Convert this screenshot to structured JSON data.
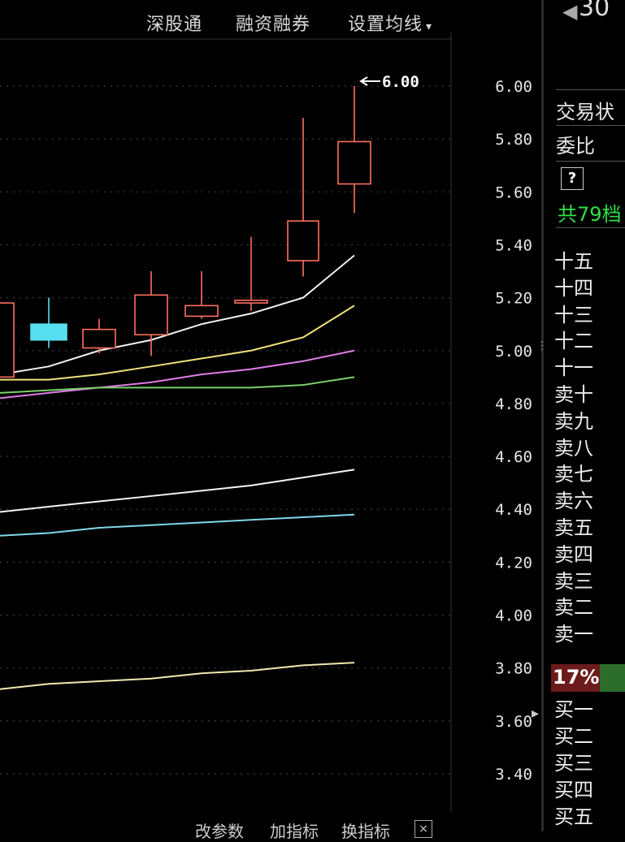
{
  "toolbar": {
    "items": [
      "深股通",
      "融资融券",
      "设置均线"
    ],
    "dropdown_icon": "caret-down-icon"
  },
  "chart_data": {
    "type": "candlestick",
    "y_ticks": [
      6.0,
      5.8,
      5.6,
      5.4,
      5.2,
      5.0,
      4.8,
      4.6,
      4.4,
      4.2,
      4.0,
      3.8,
      3.6,
      3.4
    ],
    "ylim": [
      3.4,
      6.0
    ],
    "grid": true,
    "max_annotation": "6.00",
    "candles": [
      {
        "open": 4.9,
        "close": 5.18,
        "high": 5.18,
        "low": 4.9,
        "color": "red"
      },
      {
        "open": 5.1,
        "close": 5.04,
        "high": 5.2,
        "low": 5.01,
        "color": "cyan"
      },
      {
        "open": 5.01,
        "close": 5.08,
        "high": 5.12,
        "low": 4.99,
        "color": "red"
      },
      {
        "open": 5.06,
        "close": 5.21,
        "high": 5.3,
        "low": 4.98,
        "color": "red"
      },
      {
        "open": 5.13,
        "close": 5.17,
        "high": 5.3,
        "low": 5.12,
        "color": "red"
      },
      {
        "open": 5.18,
        "close": 5.19,
        "high": 5.43,
        "low": 5.15,
        "color": "red"
      },
      {
        "open": 5.34,
        "close": 5.49,
        "high": 5.88,
        "low": 5.28,
        "color": "red"
      },
      {
        "open": 5.63,
        "close": 5.79,
        "high": 6.0,
        "low": 5.52,
        "color": "red"
      }
    ],
    "moving_averages": [
      {
        "color": "#f2f2f2",
        "values": [
          4.91,
          4.94,
          5.0,
          5.04,
          5.1,
          5.14,
          5.2,
          5.36
        ]
      },
      {
        "color": "#f0e27a",
        "values": [
          4.89,
          4.89,
          4.91,
          4.94,
          4.97,
          5.0,
          5.05,
          5.17
        ]
      },
      {
        "color": "#e07ce8",
        "values": [
          4.82,
          4.84,
          4.86,
          4.88,
          4.91,
          4.93,
          4.96,
          5.0
        ]
      },
      {
        "color": "#7ad06a",
        "values": [
          4.84,
          4.85,
          4.86,
          4.86,
          4.86,
          4.86,
          4.87,
          4.9
        ]
      },
      {
        "color": "#f5f5f5",
        "values": [
          4.39,
          4.41,
          4.43,
          4.45,
          4.47,
          4.49,
          4.52,
          4.55
        ]
      },
      {
        "color": "#7fd8e8",
        "values": [
          4.3,
          4.31,
          4.33,
          4.34,
          4.35,
          4.36,
          4.37,
          4.38
        ]
      },
      {
        "color": "#f0eab0",
        "values": [
          3.72,
          3.74,
          3.75,
          3.76,
          3.78,
          3.79,
          3.81,
          3.82
        ]
      }
    ]
  },
  "panel": {
    "title": "30",
    "rows": [
      "交易状",
      "委比"
    ],
    "help": "?",
    "total_levels": "共79档",
    "asks": [
      "十五",
      "十四",
      "十三",
      "十二",
      "十一",
      "卖十",
      "卖九",
      "卖八",
      "卖七",
      "卖六",
      "卖五",
      "卖四",
      "卖三",
      "卖二",
      "卖一"
    ],
    "ratio": "17%",
    "bids": [
      "买一",
      "买二",
      "买三",
      "买四",
      "买五"
    ]
  },
  "bottom": {
    "tabs": [
      "改参数",
      "加指标",
      "换指标"
    ],
    "close": "×"
  },
  "colors": {
    "red": "#ff6f5e",
    "cyan": "#56e0ef",
    "grid": "#3c3c3c",
    "green_text": "#2fe046"
  }
}
